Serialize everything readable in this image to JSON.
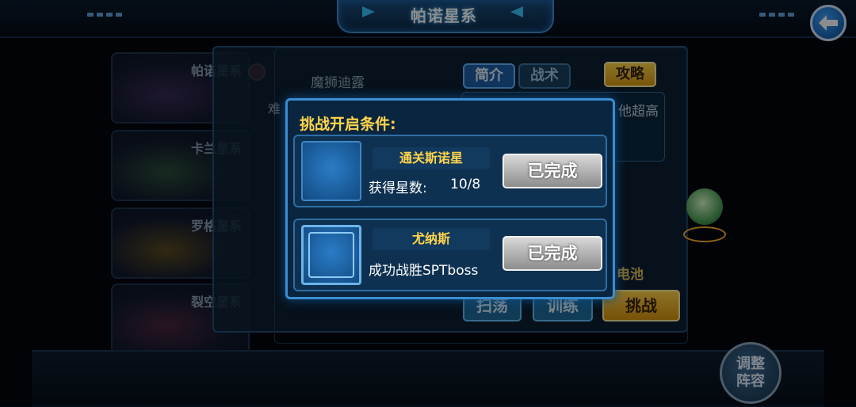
{
  "header": {
    "title": "帕诺星系"
  },
  "planets": [
    {
      "label": "帕诺星系"
    },
    {
      "label": "卡兰星系"
    },
    {
      "label": "罗格星系"
    },
    {
      "label": "裂空星系"
    }
  ],
  "detail": {
    "monster_name": "魔狮迪露",
    "difficulty_label": "难",
    "tabs": [
      {
        "label": "简介"
      },
      {
        "label": "战术"
      }
    ],
    "guide_label": "攻略",
    "description_fragment": "他超高",
    "energy_label": "电池",
    "actions": {
      "sweep": "扫荡",
      "train": "训练",
      "challenge": "挑战"
    }
  },
  "formation_button": {
    "line1": "调整",
    "line2": "阵容"
  },
  "modal": {
    "title": "挑战开启条件:",
    "conditions": [
      {
        "name": "通关斯诺星",
        "requirement": "获得星数:",
        "value": "10/8",
        "status": "已完成"
      },
      {
        "name": "尤纳斯",
        "requirement": "成功战胜SPTboss",
        "status": "已完成"
      }
    ]
  },
  "colors": {
    "accent_gold": "#ffd54a",
    "frame_blue": "#3a8ed0",
    "completed_gray": "#8d8d8d"
  },
  "icons": {
    "back": "back-arrow-icon",
    "badge": "spider-badge-icon"
  }
}
